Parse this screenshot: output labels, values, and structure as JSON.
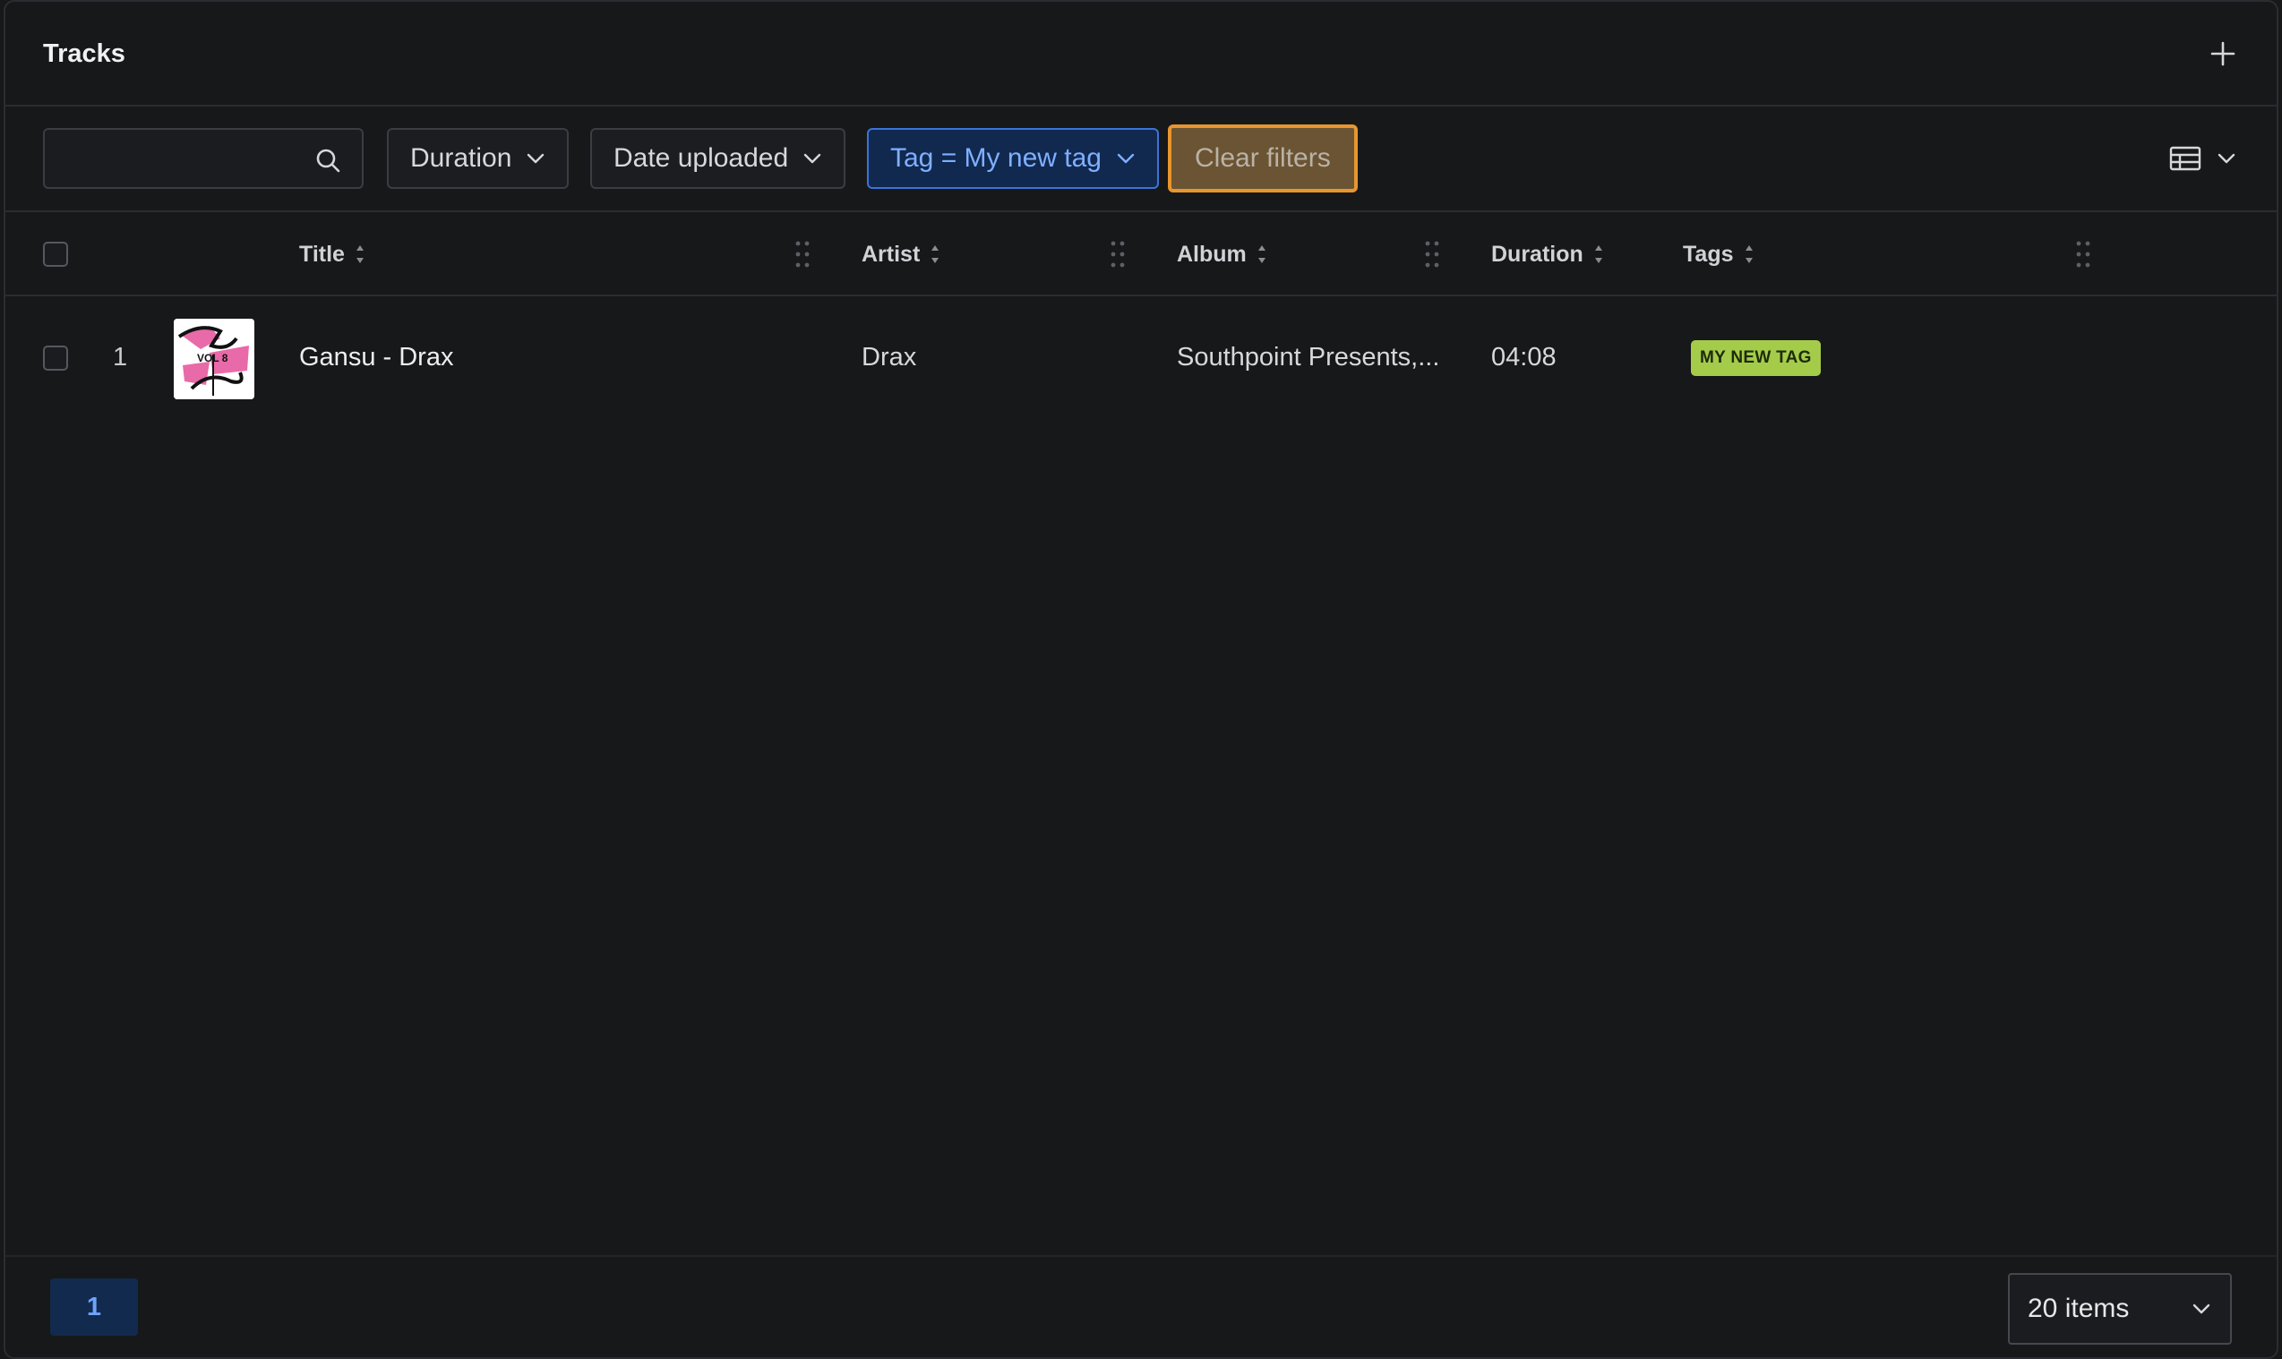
{
  "header": {
    "title": "Tracks",
    "add_icon": "plus-icon"
  },
  "filters": {
    "search": {
      "value": "",
      "placeholder": "",
      "icon": "search-icon"
    },
    "duration_label": "Duration",
    "date_uploaded_label": "Date uploaded",
    "tag_filter_label": "Tag = My new tag",
    "clear_label": "Clear filters",
    "view_icon": "table-view-icon"
  },
  "table": {
    "columns": [
      "Title",
      "Artist",
      "Album",
      "Duration",
      "Tags"
    ],
    "rows": [
      {
        "index": "1",
        "cover_text": "VOL 8",
        "title": "Gansu - Drax",
        "artist": "Drax",
        "album": "Southpoint Presents,...",
        "duration": "04:08",
        "tags": [
          "MY NEW TAG"
        ]
      }
    ]
  },
  "pagination": {
    "current_page": "1",
    "page_size": "20 items"
  },
  "colors": {
    "background": "#17181a",
    "active_filter": "#3b74d9",
    "clear_highlight": "#e8962e",
    "tag": "#a4cc4a"
  }
}
